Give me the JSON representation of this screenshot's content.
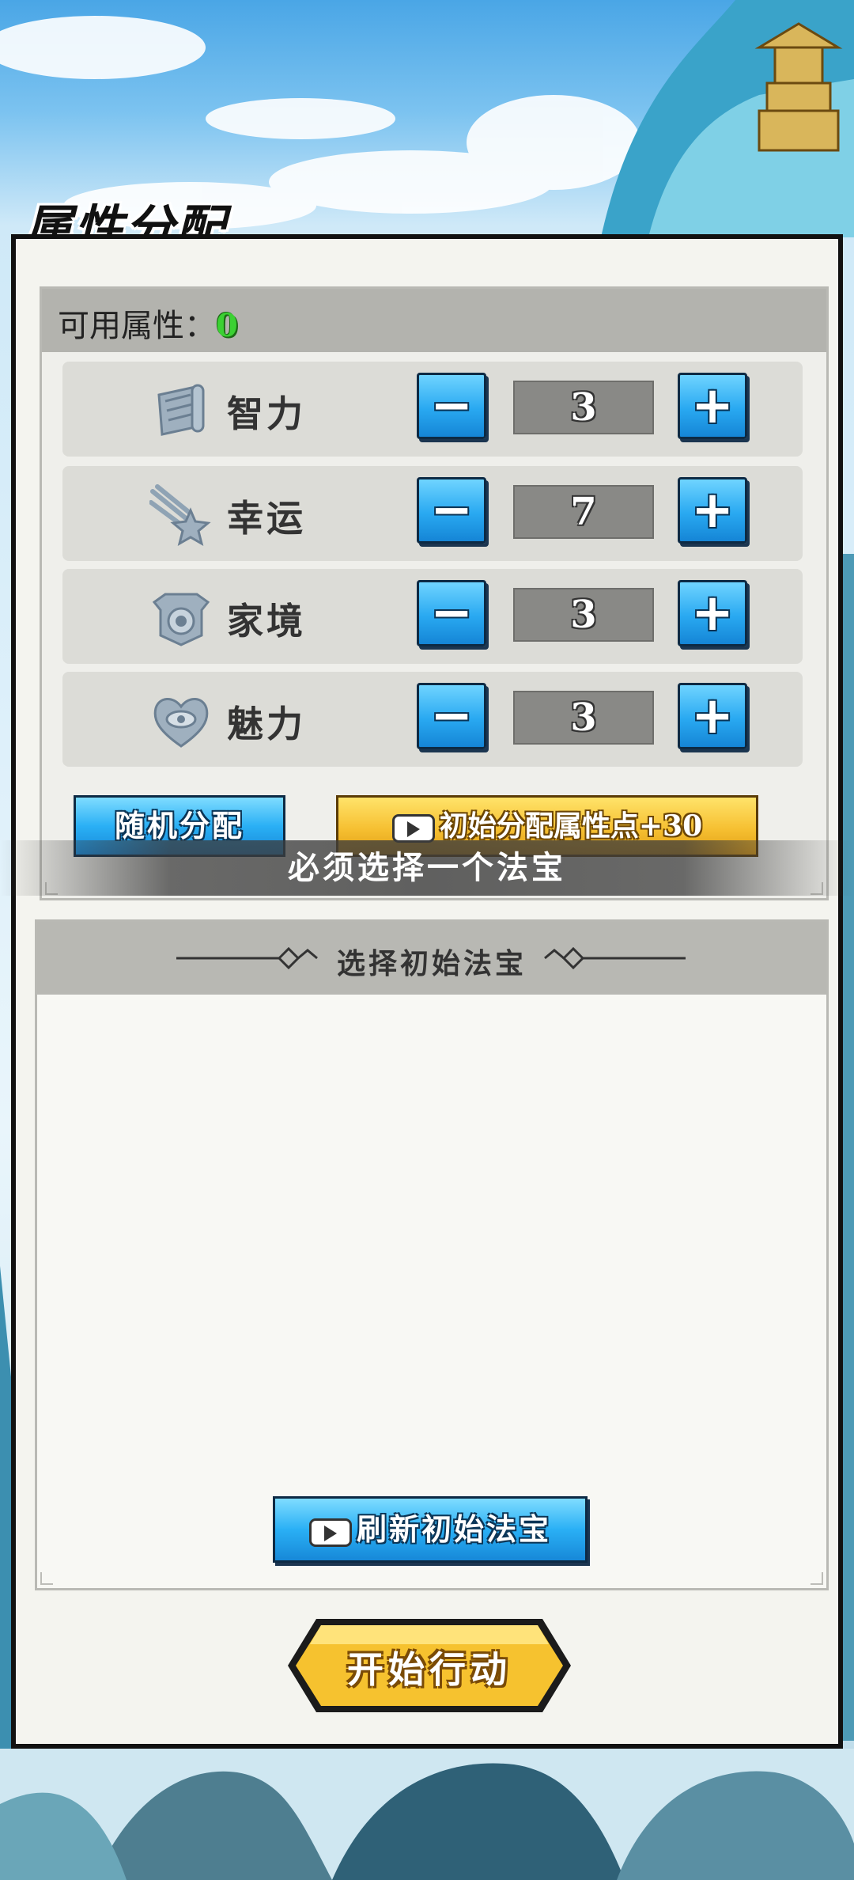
{
  "panel": {
    "title": "属性分配"
  },
  "available": {
    "label": "可用属性：",
    "value": "0"
  },
  "attributes": [
    {
      "name": "智力",
      "icon": "scroll-icon",
      "value": "3"
    },
    {
      "name": "幸运",
      "icon": "shooting-star-icon",
      "value": "7"
    },
    {
      "name": "家境",
      "icon": "coin-emblem-icon",
      "value": "3"
    },
    {
      "name": "魅力",
      "icon": "heart-eye-icon",
      "value": "3"
    }
  ],
  "controls": {
    "minus": "−",
    "plus": "+"
  },
  "buttons": {
    "random": "随机分配",
    "bonus": "初始分配属性点+30",
    "refresh": "刷新初始法宝",
    "start": "开始行动"
  },
  "toast": "必须选择一个法宝",
  "treasure": {
    "title": "选择初始法宝"
  },
  "colors": {
    "accent_blue": "#29a9f1",
    "accent_gold": "#f6c032",
    "available_value": "#3bd133"
  }
}
